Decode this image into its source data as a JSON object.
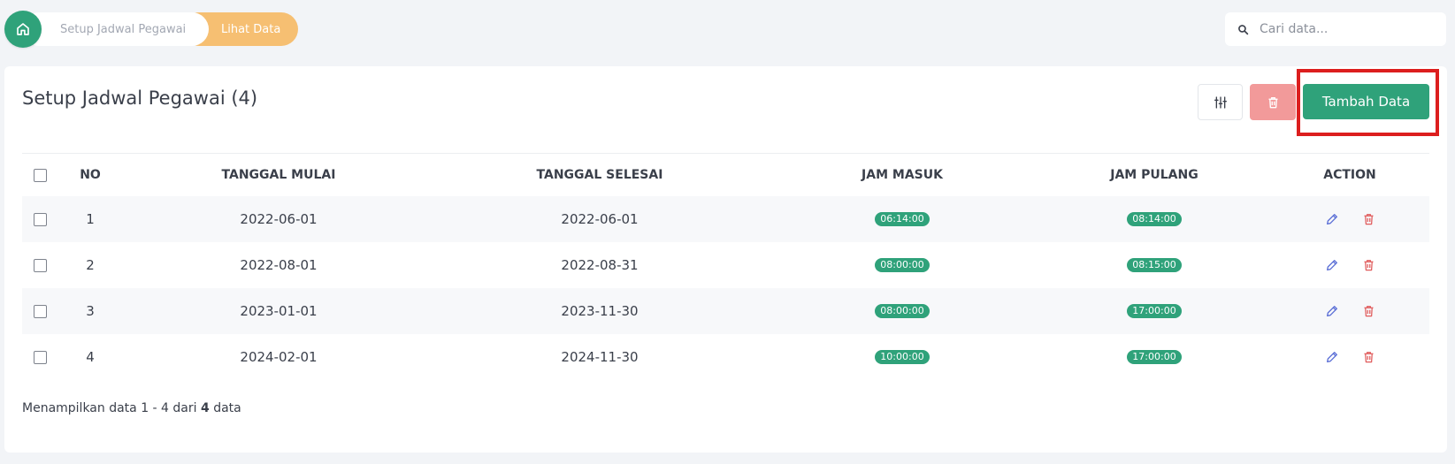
{
  "breadcrumb": {
    "home_icon": "home-icon",
    "items": [
      "Setup Jadwal Pegawai",
      "Lihat Data"
    ],
    "colors": {
      "home": "#2fa27a",
      "active": "#f6bf72"
    }
  },
  "search": {
    "placeholder": "Cari data...",
    "icon": "search-icon"
  },
  "card": {
    "title": "Setup Jadwal Pegawai (4)",
    "add_label": "Tambah Data"
  },
  "table": {
    "headers": {
      "no": "NO",
      "start": "TANGGAL MULAI",
      "end": "TANGGAL SELESAI",
      "in": "JAM MASUK",
      "out": "JAM PULANG",
      "action": "ACTION"
    },
    "rows": [
      {
        "no": "1",
        "start": "2022-06-01",
        "end": "2022-06-01",
        "in": "06:14:00",
        "out": "08:14:00"
      },
      {
        "no": "2",
        "start": "2022-08-01",
        "end": "2022-08-31",
        "in": "08:00:00",
        "out": "08:15:00"
      },
      {
        "no": "3",
        "start": "2023-01-01",
        "end": "2023-11-30",
        "in": "08:00:00",
        "out": "17:00:00"
      },
      {
        "no": "4",
        "start": "2024-02-01",
        "end": "2024-11-30",
        "in": "10:00:00",
        "out": "17:00:00"
      }
    ]
  },
  "footer": {
    "prefix": "Menampilkan data 1 - 4 dari",
    "total": "4",
    "suffix": "data"
  },
  "colors": {
    "primary": "#2fa27a",
    "danger": "#f29a9a",
    "edit_icon": "#5b6fd6",
    "delete_icon": "#e05a5a"
  }
}
